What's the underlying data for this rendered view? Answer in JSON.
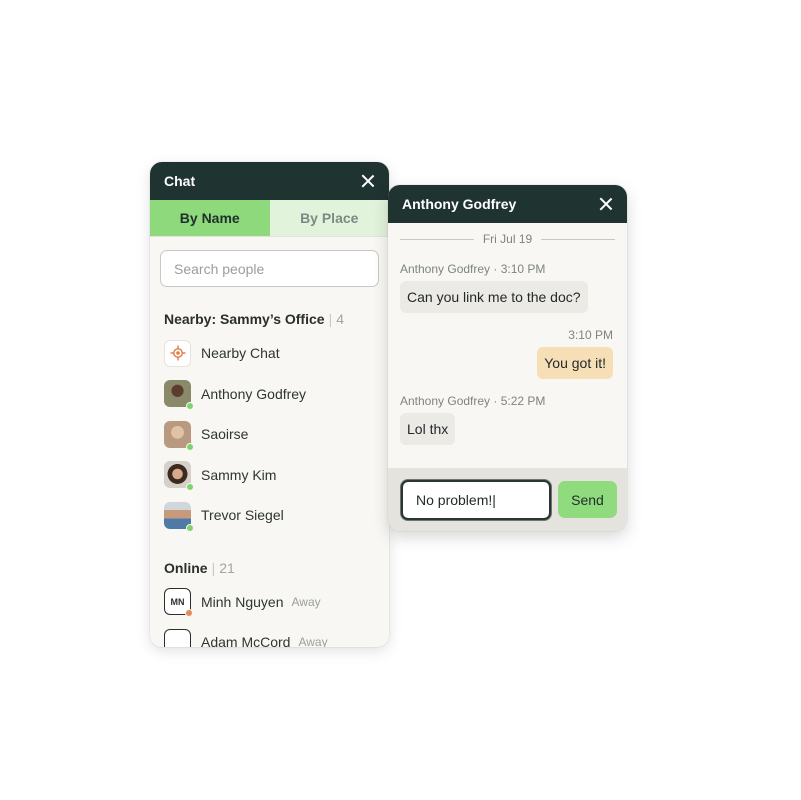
{
  "chat_panel": {
    "title": "Chat",
    "tabs": [
      {
        "label": "By Name",
        "active": true
      },
      {
        "label": "By Place",
        "active": false
      }
    ],
    "search": {
      "placeholder": "Search people",
      "value": ""
    },
    "nearby_section": {
      "title": "Nearby: Sammy’s Office",
      "count": "4"
    },
    "nearby_items": [
      {
        "name": "Nearby Chat",
        "icon": "location-target-icon"
      },
      {
        "name": "Anthony Godfrey",
        "status": "online"
      },
      {
        "name": "Saoirse",
        "status": "online"
      },
      {
        "name": "Sammy Kim",
        "status": "online"
      },
      {
        "name": "Trevor Siegel",
        "status": "online"
      }
    ],
    "online_section": {
      "title": "Online",
      "count": "21"
    },
    "online_items": [
      {
        "name": "Minh Nguyen",
        "initials": "MN",
        "status_text": "Away",
        "status": "away"
      },
      {
        "name": "Adam McCord",
        "initials": "",
        "status_text": "Away",
        "status": "away"
      }
    ]
  },
  "conversation": {
    "title": "Anthony Godfrey",
    "date_divider": "Fri Jul 19",
    "messages": [
      {
        "direction": "in",
        "meta": "Anthony Godfrey · 3:10 PM",
        "text": "Can you link me to the doc?"
      },
      {
        "direction": "out",
        "meta": "3:10 PM",
        "text": "You got it!"
      },
      {
        "direction": "in",
        "meta": "Anthony Godfrey · 5:22 PM",
        "text": "Lol thx"
      }
    ],
    "composer": {
      "value": "No problem!|",
      "send_label": "Send"
    }
  },
  "colors": {
    "header": "#1f3331",
    "tab_active": "#8dd97b",
    "tab_inactive": "#e2f3dc",
    "online": "#7ed46b",
    "away": "#e58b55",
    "outgoing_bubble": "#f6dfb6",
    "send_button": "#8fdb7d"
  }
}
